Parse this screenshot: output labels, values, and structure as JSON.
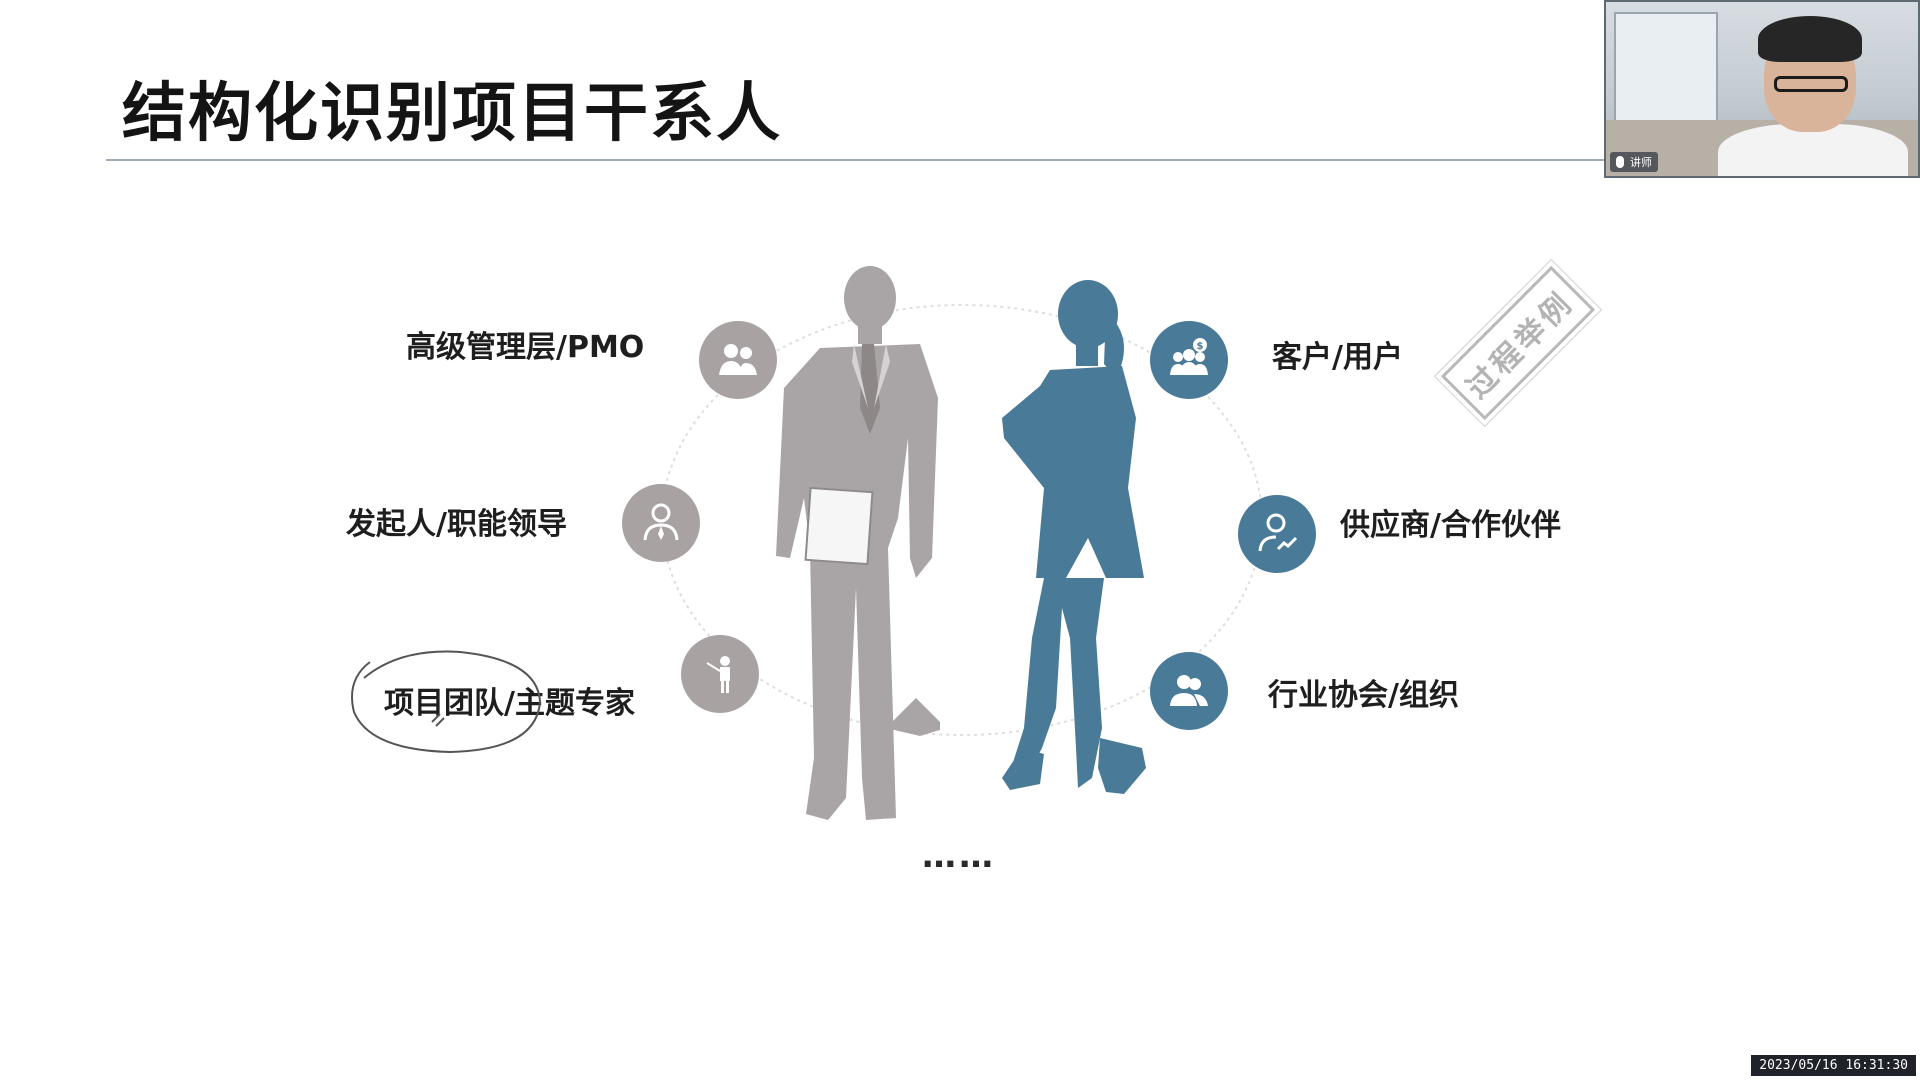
{
  "slide": {
    "title": "结构化识别项目干系人",
    "ellipsis": "……",
    "stamp_text": "过程举例"
  },
  "stakeholders_left": [
    {
      "label": "高级管理层/PMO",
      "icon": "executives-icon"
    },
    {
      "label": "发起人/职能领导",
      "icon": "leader-icon"
    },
    {
      "label": "项目团队/主题专家",
      "icon": "presenter-icon"
    }
  ],
  "stakeholders_right": [
    {
      "label": "客户/用户",
      "icon": "customers-dollar-icon"
    },
    {
      "label": "供应商/合作伙伴",
      "icon": "partner-growth-icon"
    },
    {
      "label": "行业协会/组织",
      "icon": "association-icon"
    }
  ],
  "webcam": {
    "name_tag": "讲师"
  },
  "timestamp": "2023/05/16 16:31:30",
  "colors": {
    "gray_circle": "#a8a2a3",
    "blue_circle": "#497a97",
    "male_figure": "#a9a4a5",
    "female_figure": "#497a97",
    "title_rule": "#9eabb8"
  }
}
